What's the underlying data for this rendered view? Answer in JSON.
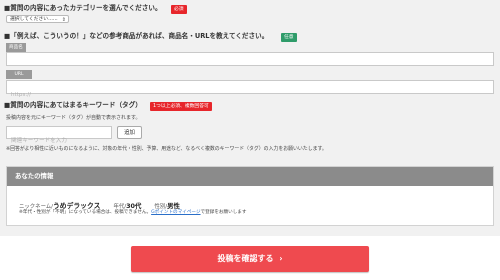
{
  "category": {
    "question": "■質問の内容にあったカテゴリーを選んでください。",
    "badge": "必須",
    "select_value": "選択してください……"
  },
  "reference": {
    "question": "■「例えば、こういうの！」などの参考商品があれば、商品名・URLを教えてください。",
    "badge": "任意",
    "product_label": "商品名",
    "url_label": "URL",
    "url_placeholder": "https://"
  },
  "keywords": {
    "question": "■質問の内容にあてはまるキーワード（タグ）",
    "badge": "1つ以上必須、複数回答可",
    "hint": "投稿内容を元にキーワード（タグ）が自動で表示されます。",
    "input_placeholder": "関連キーワードを入力",
    "add_button": "追加",
    "note": "※回答がより相性に近いものになるように、対象の年代・性別、予算、用途など、なるべく複数のキーワード（タグ）の入力をお願いいたします。"
  },
  "your_info": {
    "heading": "あなたの情報",
    "nickname_label": "ニックネーム/",
    "nickname_value": "うめデラックス",
    "age_label": "年代/",
    "age_value": "30代",
    "gender_label": "性別/",
    "gender_value": "男性",
    "notice_prefix": "※年代・性別が「不明」になっている場合は、投稿できません。",
    "notice_link": "Gポイントのマイページ",
    "notice_suffix": "で登録をお願いします"
  },
  "submit": {
    "label": "投稿を確認する",
    "arrow": "›"
  },
  "colors": {
    "required_badge": "#e7262b",
    "optional_badge": "#2f9c6a",
    "confirm_button": "#ef4a4f",
    "link": "#2a6fc9"
  }
}
